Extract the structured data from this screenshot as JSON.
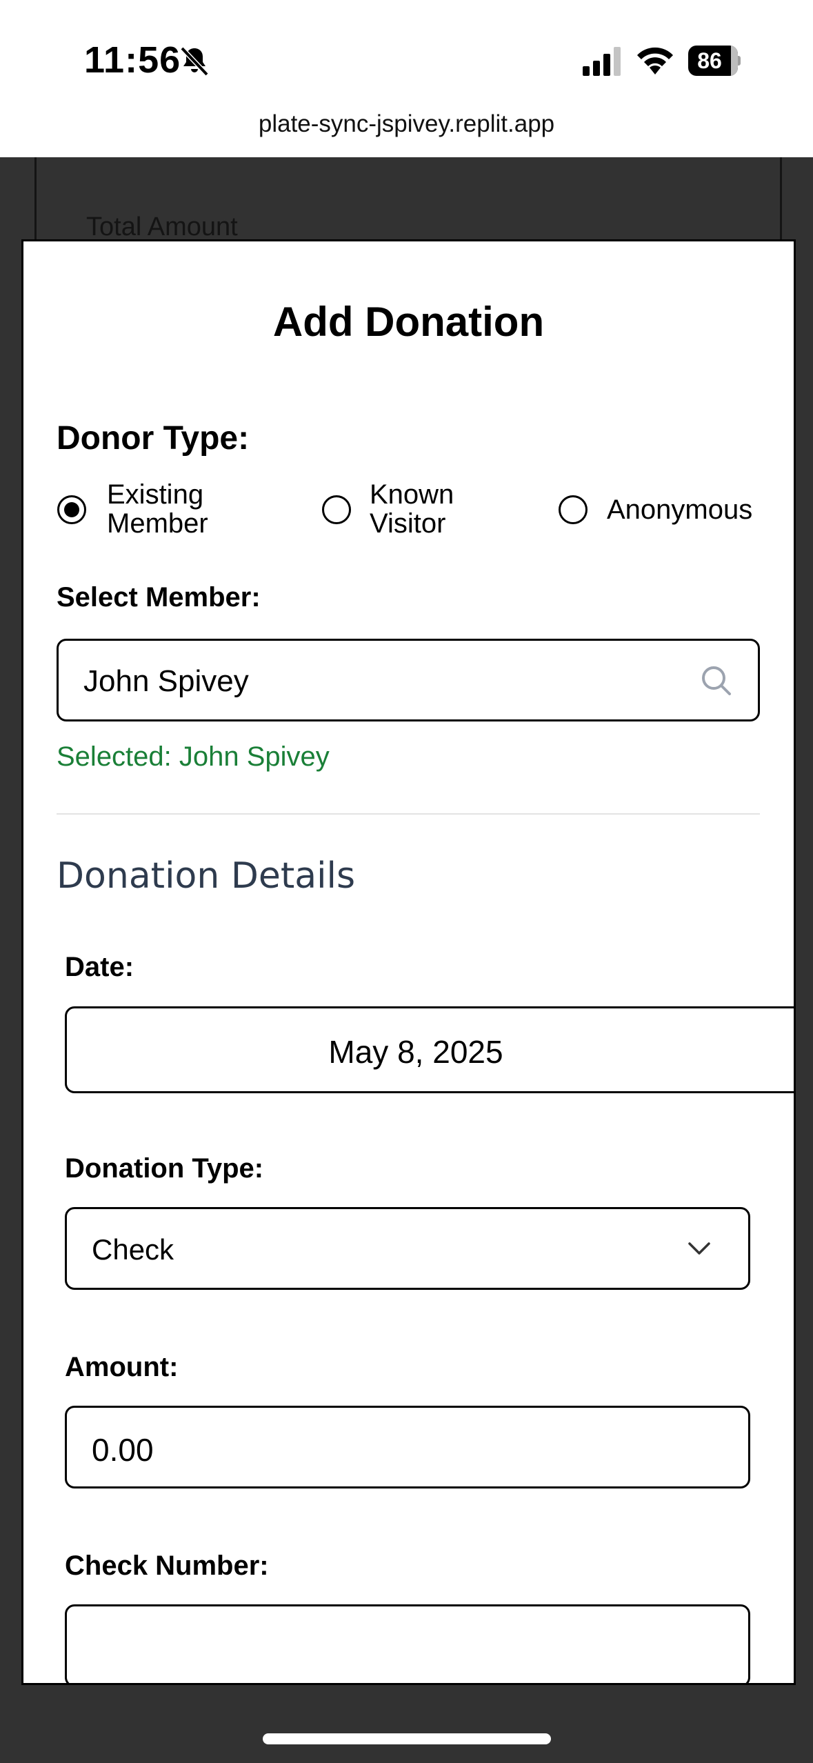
{
  "status_bar": {
    "time": "11:56",
    "battery": "86",
    "url": "plate-sync-jspivey.replit.app"
  },
  "background": {
    "peek_text": "Total Amount"
  },
  "modal": {
    "title": "Add Donation",
    "donor_type": {
      "label": "Donor Type:",
      "options": [
        {
          "line1": "Existing",
          "line2": "Member",
          "selected": true
        },
        {
          "line1": "Known",
          "line2": "Visitor",
          "selected": false
        },
        {
          "line1": "Anonymous",
          "line2": "",
          "selected": false
        }
      ]
    },
    "select_member": {
      "label": "Select Member:",
      "value": "John Spivey",
      "selected_text": "Selected: John Spivey"
    },
    "details": {
      "section_title": "Donation Details",
      "date_label": "Date:",
      "date_value": "May 8, 2025",
      "donation_type_label": "Donation Type:",
      "donation_type_value": "Check",
      "amount_label": "Amount:",
      "amount_value": "0.00",
      "check_number_label": "Check Number:",
      "check_number_value": ""
    }
  },
  "colors": {
    "selected_text": "#1a7f37",
    "section_title": "#2e3b4e",
    "overlay": "#323232"
  }
}
